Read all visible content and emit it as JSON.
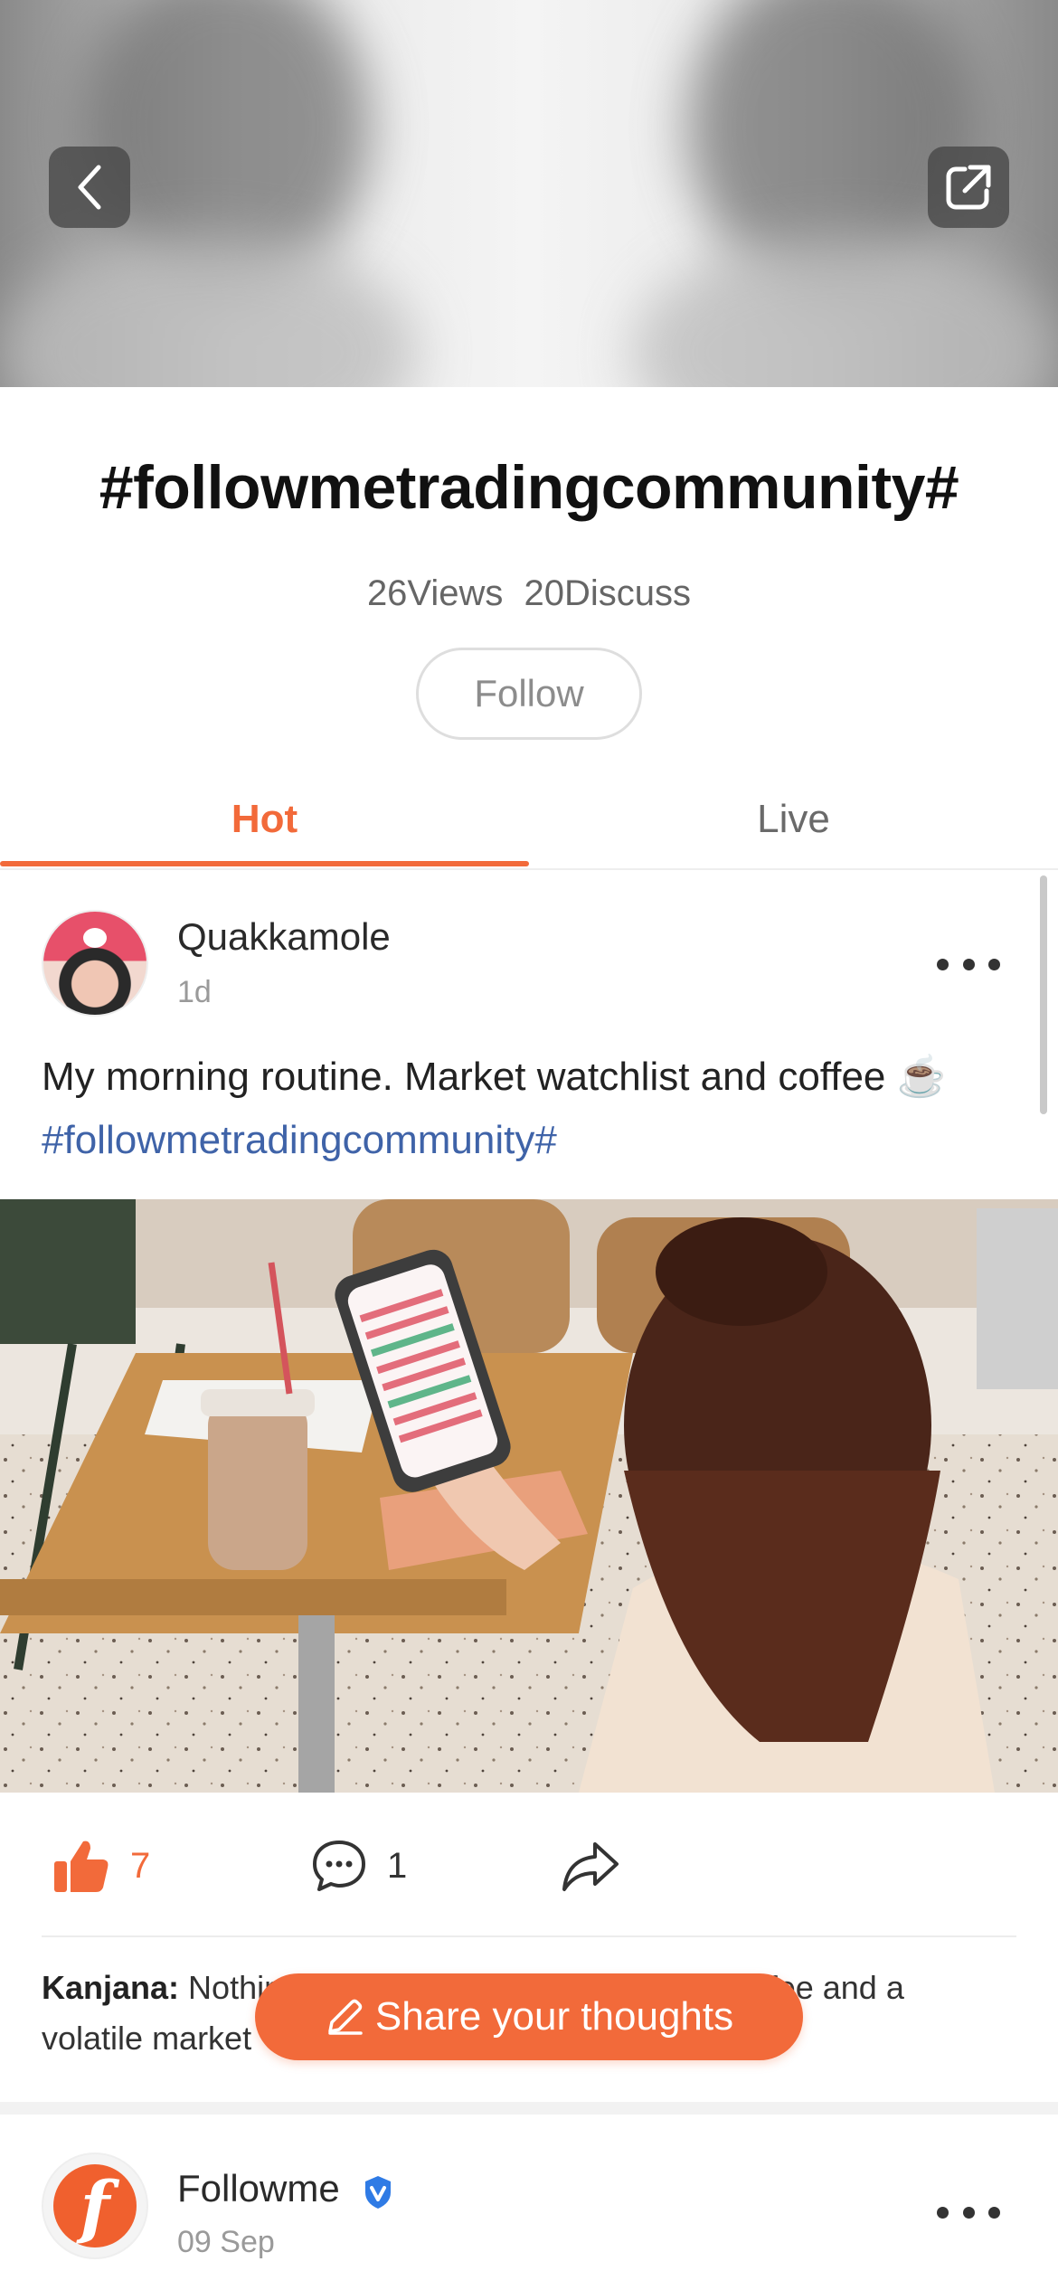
{
  "header": {
    "back_icon": "chevron-left-icon",
    "share_icon": "external-link-icon"
  },
  "topic": {
    "title": "#followmetradingcommunity#",
    "views": "26Views",
    "discuss": "20Discuss",
    "follow_label": "Follow"
  },
  "tabs": [
    {
      "label": "Hot",
      "active": true
    },
    {
      "label": "Live",
      "active": false
    }
  ],
  "posts": [
    {
      "author": "Quakkamole",
      "time": "1d",
      "text": "My morning routine. Market watchlist and coffee ☕️",
      "hashtag": "#followmetradingcommunity#",
      "likes": "7",
      "comments": "1",
      "comment_preview": {
        "user": "Kanjana:",
        "text": " Nothing makes a morning like strong coffee and a volatile market"
      }
    },
    {
      "author": "Followme",
      "time": "09 Sep",
      "verified": true
    }
  ],
  "compose": {
    "label": "Share your thoughts"
  },
  "colors": {
    "accent": "#f26a3a",
    "hashtag": "#3f63a8",
    "verified": "#2f7be5"
  }
}
